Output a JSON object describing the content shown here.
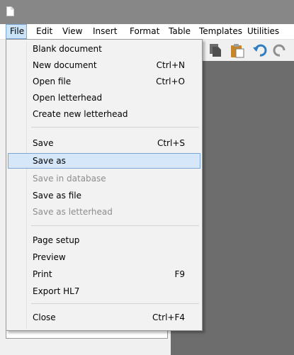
{
  "menubar": {
    "items": [
      "File",
      "Edit",
      "View",
      "Insert",
      "Format",
      "Table",
      "Templates",
      "Utilities"
    ]
  },
  "file_menu": {
    "items": [
      {
        "label": "Blank document",
        "shortcut": "",
        "disabled": false
      },
      {
        "label": "New document",
        "shortcut": "Ctrl+N",
        "disabled": false
      },
      {
        "label": "Open file",
        "shortcut": "Ctrl+O",
        "disabled": false
      },
      {
        "label": "Open letterhead",
        "shortcut": "",
        "disabled": false
      },
      {
        "label": "Create new letterhead",
        "shortcut": "",
        "disabled": false
      },
      {
        "label": "Save",
        "shortcut": "Ctrl+S",
        "disabled": false
      },
      {
        "label": "Save as",
        "shortcut": "",
        "disabled": false,
        "highlighted": true
      },
      {
        "label": "Save in database",
        "shortcut": "",
        "disabled": true
      },
      {
        "label": "Save as file",
        "shortcut": "",
        "disabled": false
      },
      {
        "label": "Save as letterhead",
        "shortcut": "",
        "disabled": true
      },
      {
        "label": "Page setup",
        "shortcut": "",
        "disabled": false
      },
      {
        "label": "Preview",
        "shortcut": "",
        "disabled": false
      },
      {
        "label": "Print",
        "shortcut": "F9",
        "disabled": false
      },
      {
        "label": "Export HL7",
        "shortcut": "",
        "disabled": false
      },
      {
        "label": "Close",
        "shortcut": "Ctrl+F4",
        "disabled": false
      }
    ]
  },
  "icons": {
    "app": "document-icon",
    "toolbar": [
      "copy-icon",
      "paste-icon",
      "undo-icon",
      "redo-icon"
    ]
  },
  "colors": {
    "titlebar": "#878787",
    "menu_highlight": "#d5e7f8",
    "menu_highlight_border": "#7ba7d8",
    "disabled_text": "#8d8d8d",
    "document_area": "#6d6d6d"
  }
}
